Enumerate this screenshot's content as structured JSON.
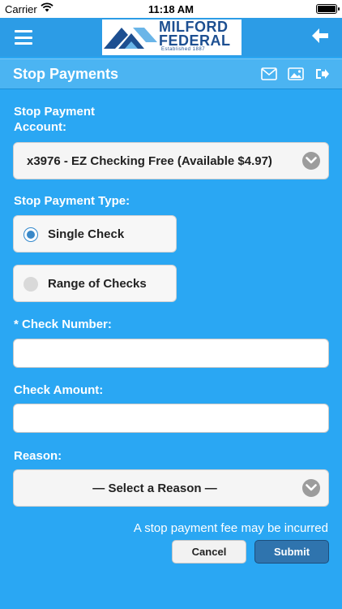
{
  "status_bar": {
    "carrier": "Carrier",
    "time": "11:18 AM"
  },
  "header": {
    "logo": {
      "line1": "MILFORD",
      "line2": "FEDERAL",
      "established": "Established 1887"
    }
  },
  "title_bar": {
    "title": "Stop Payments"
  },
  "form": {
    "account_label_line1": "Stop Payment",
    "account_label_line2": "Account:",
    "account_value": "x3976 - EZ Checking Free (Available $4.97)",
    "type_label": "Stop Payment Type:",
    "type_options": [
      {
        "label": "Single Check",
        "selected": true
      },
      {
        "label": "Range of Checks",
        "selected": false
      }
    ],
    "check_number_label": "* Check Number:",
    "check_number_value": "",
    "check_amount_label": "Check Amount:",
    "check_amount_value": "",
    "reason_label": "Reason:",
    "reason_value": "— Select a Reason —",
    "fee_note": "A stop payment fee may be incurred",
    "cancel_label": "Cancel",
    "submit_label": "Submit"
  },
  "colors": {
    "background": "#2aa7f3",
    "header": "#2c9ce6",
    "title_bar": "#4bb4f2",
    "brand_navy": "#1d4f91",
    "submit": "#2f74ae"
  },
  "icons": [
    "wifi-icon",
    "battery-icon",
    "menu-icon",
    "back-arrow-icon",
    "mail-icon",
    "image-icon",
    "logout-icon",
    "chevron-down-icon"
  ]
}
